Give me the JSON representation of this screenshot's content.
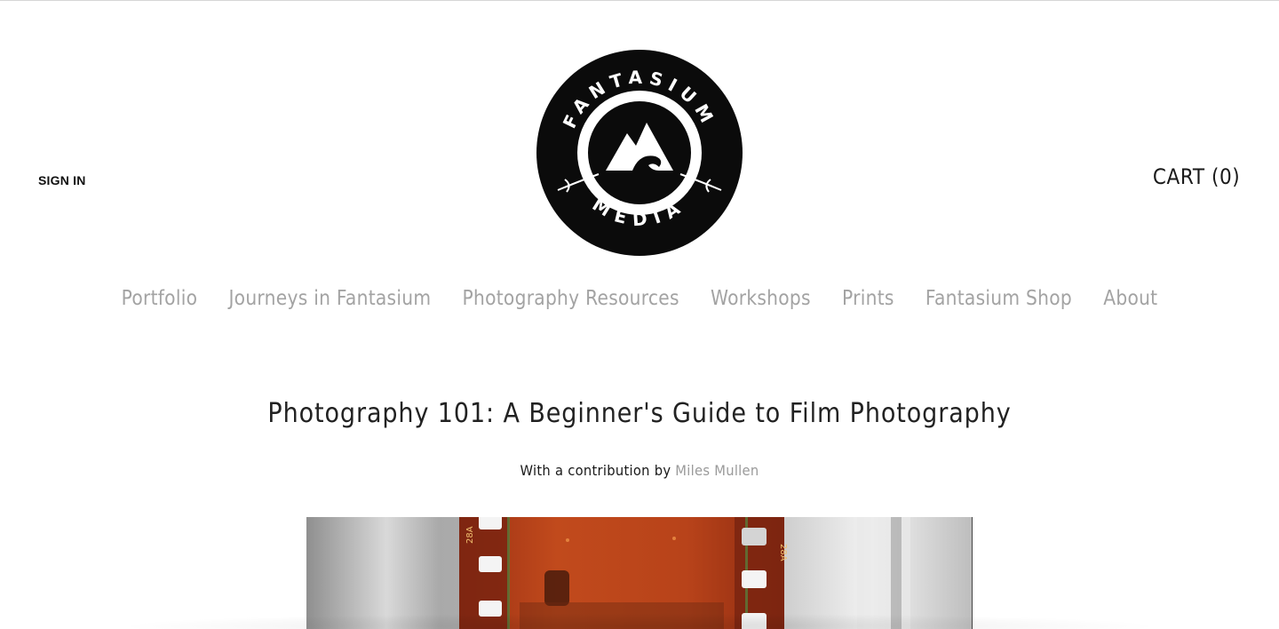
{
  "header": {
    "sign_in_label": "SIGN IN",
    "cart_label": "CART (0)",
    "logo": {
      "top_text": "FANTASIUM",
      "bottom_text": "MEDIA",
      "icon": "mountain-wave-icon"
    }
  },
  "nav": {
    "items": [
      {
        "label": "Portfolio"
      },
      {
        "label": "Journeys in Fantasium"
      },
      {
        "label": "Photography Resources"
      },
      {
        "label": "Workshops"
      },
      {
        "label": "Prints"
      },
      {
        "label": "Fantasium Shop"
      },
      {
        "label": "About"
      }
    ]
  },
  "post": {
    "title": "Photography 101: A Beginner's Guide to Film Photography",
    "byline_prefix": "With a contribution by",
    "author": "Miles Mullen",
    "hero_image": {
      "strip_code_left": "28A",
      "strip_code_right": "28A"
    }
  },
  "colors": {
    "nav_text": "#a3a3a3",
    "author_link": "#9a9a9a",
    "logo_dark": "#0b0b0b",
    "film_orange": "#b8431a"
  }
}
